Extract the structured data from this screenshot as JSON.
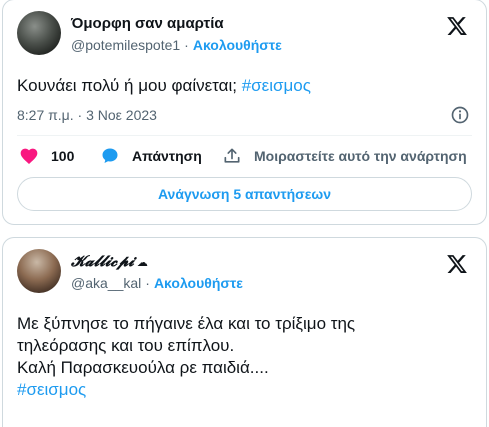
{
  "tweets": [
    {
      "display_name": "Όμορφη σαν αμαρτία",
      "handle": "@potemilespote1",
      "separator": "·",
      "follow_label": "Ακολουθήστε",
      "text_plain": "Κουνάει πολύ ή μου φαίνεται; ",
      "hashtag": "#σεισμος",
      "timestamp": "8:27 π.μ. · 3 Νοε 2023",
      "likes": "100",
      "reply_label": "Απάντηση",
      "share_label": "Μοιραστείτε αυτό την ανάρτηση",
      "read_replies_label": "Ανάγνωση 5 απαντήσεων"
    },
    {
      "display_name": "𝓚𝓪𝓵𝓵𝓲𝓬𝓹𝓲",
      "handle": "@aka__kal",
      "separator": "·",
      "follow_label": "Ακολουθήστε",
      "text_line1": "Με ξύπνησε το πήγαινε έλα και το τρίξιμο της",
      "text_line2": "τηλεόρασης και του επίπλου.",
      "text_line3": "Καλή Παρασκευούλα ρε παιδιά....",
      "hashtag": "#σεισμος"
    }
  ],
  "icons": {
    "x_logo": "x-logo-icon",
    "info": "info-icon",
    "heart": "heart-icon",
    "reply": "reply-bubble-icon",
    "share": "share-upload-icon",
    "cloud": "cloud-icon"
  },
  "colors": {
    "accent": "#1d9bf0",
    "like": "#f91880",
    "muted": "#536471",
    "text": "#0f1419",
    "border": "#cfd9de"
  }
}
